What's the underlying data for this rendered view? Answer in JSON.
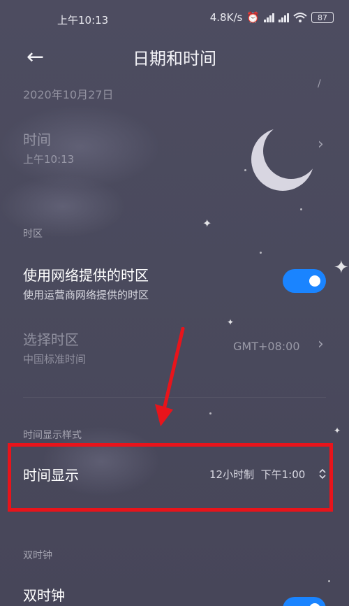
{
  "status_bar": {
    "time": "上午10:13",
    "speed": "4.8K/s",
    "battery": "87",
    "alarm_icon": "alarm-icon",
    "wifi_icon": "wifi-icon"
  },
  "header": {
    "title": "日期和时间",
    "back_icon": "back-arrow-icon"
  },
  "date_row": {
    "value": "2020年10月27日"
  },
  "time_row": {
    "label": "时间",
    "value": "上午10:13"
  },
  "timezone_section": {
    "header": "时区",
    "network_timezone": {
      "label": "使用网络提供的时区",
      "sublabel": "使用运营商网络提供的时区",
      "enabled": true
    },
    "select_timezone": {
      "label": "选择时区",
      "sublabel": "中国标准时间",
      "value": "GMT+08:00"
    }
  },
  "display_style_section": {
    "header": "时间显示样式",
    "time_display": {
      "label": "时间显示",
      "value": "12小时制  下午1:00"
    }
  },
  "dual_clock_section": {
    "header": "双时钟",
    "dual_clock": {
      "label": "双时钟",
      "enabled": true
    }
  },
  "colors": {
    "background": "#4a4a5c",
    "accent": "#1a84ff",
    "annotation": "#e8141b"
  }
}
